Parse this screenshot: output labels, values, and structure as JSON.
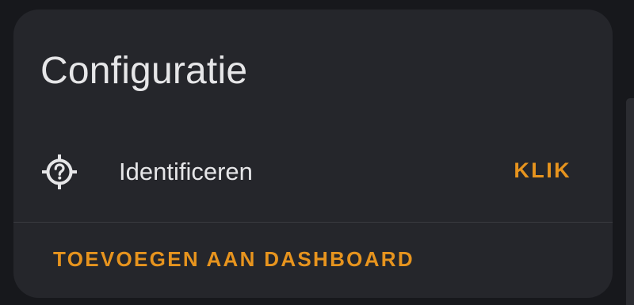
{
  "card": {
    "title": "Configuratie"
  },
  "entity": {
    "icon": "crosshairs-question-icon",
    "name": "Identificeren",
    "action_label": "KLIK"
  },
  "footer": {
    "button_label": "TOEVOEGEN AAN DASHBOARD"
  },
  "colors": {
    "background": "#17181c",
    "card": "#25262b",
    "text": "#e6e6e8",
    "accent": "#e7941e",
    "divider": "#3a3b40"
  }
}
